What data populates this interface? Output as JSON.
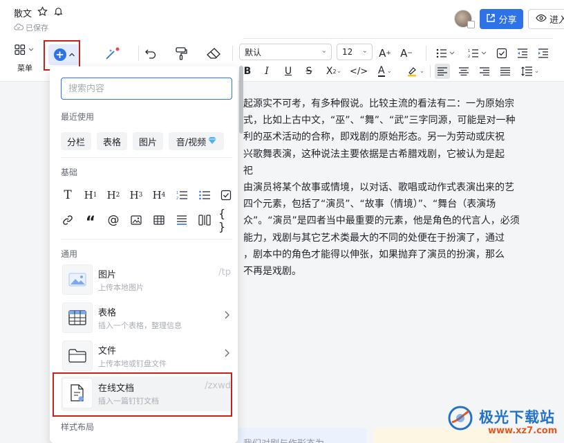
{
  "header": {
    "doc_title": "散文",
    "saved_status": "已保存",
    "share_label": "分享",
    "enter_label": "进入"
  },
  "toolbar": {
    "menu_label": "菜单",
    "font_family": "默认",
    "font_size": "12"
  },
  "insert_panel": {
    "search_placeholder": "搜索内容",
    "recent": {
      "title": "最近使用",
      "items": [
        "分栏",
        "表格",
        "图片",
        "音/视频"
      ]
    },
    "basic": {
      "title": "基础",
      "row1": [
        "text-icon",
        "heading1-icon",
        "heading2-icon",
        "heading3-icon",
        "heading4-icon",
        "ordered-list-icon",
        "bullet-list-icon",
        "checkbox-icon"
      ],
      "row2": [
        "link-icon",
        "quote-icon",
        "mention-icon",
        "image-icon",
        "table-icon",
        "align-block-icon",
        "columns-icon",
        "code-block-icon"
      ]
    },
    "general": {
      "title": "通用",
      "items": [
        {
          "title": "图片",
          "subtitle": "上传本地图片",
          "hint": "/tp"
        },
        {
          "title": "表格",
          "subtitle": "插入一个表格，整理信息",
          "hint": ""
        },
        {
          "title": "文件",
          "subtitle": "上传本地或钉盘文件",
          "hint": ""
        },
        {
          "title": "在线文档",
          "subtitle": "插入一篇钉钉文档",
          "hint": "/zxwd"
        }
      ]
    },
    "layout": {
      "title": "样式布局"
    }
  },
  "document": {
    "paragraph_lines": [
      "起源实不可考，有多种假说。比较主流的看法有二：一为原始宗",
      "式，比如上古中文，“巫”、“舞”、“武”三字同源，可能是对一种",
      "利的巫术活动的合称，即戏剧的原始形态。另一为劳动或庆祝",
      "兴歌舞表演，这种说法主要依据是古希腊戏剧，它被认为是起",
      "祀",
      "由演员将某个故事或情境，以对话、歌唱或动作式表演出来的艺",
      "四个元素，包括了“演员”、“故事（情境）”、“舞台（表演场",
      "众”。“演员”是四者当中最重要的元素，他是角色的代言人，必须",
      "能力，戏剧与其它艺术类最大的不同的处便在于扮演了，通过",
      "，剧本中的角色才能得以伸张，如果抛弃了演员的扮演，那么",
      "不再是戏剧。"
    ],
    "bottom_snippet": "我们对剧与作形态为"
  },
  "watermark": {
    "name": "极光下载站",
    "url": "www.xz7.com"
  },
  "colors": {
    "accent": "#2e72e8",
    "highlight_box": "#c8201e"
  }
}
